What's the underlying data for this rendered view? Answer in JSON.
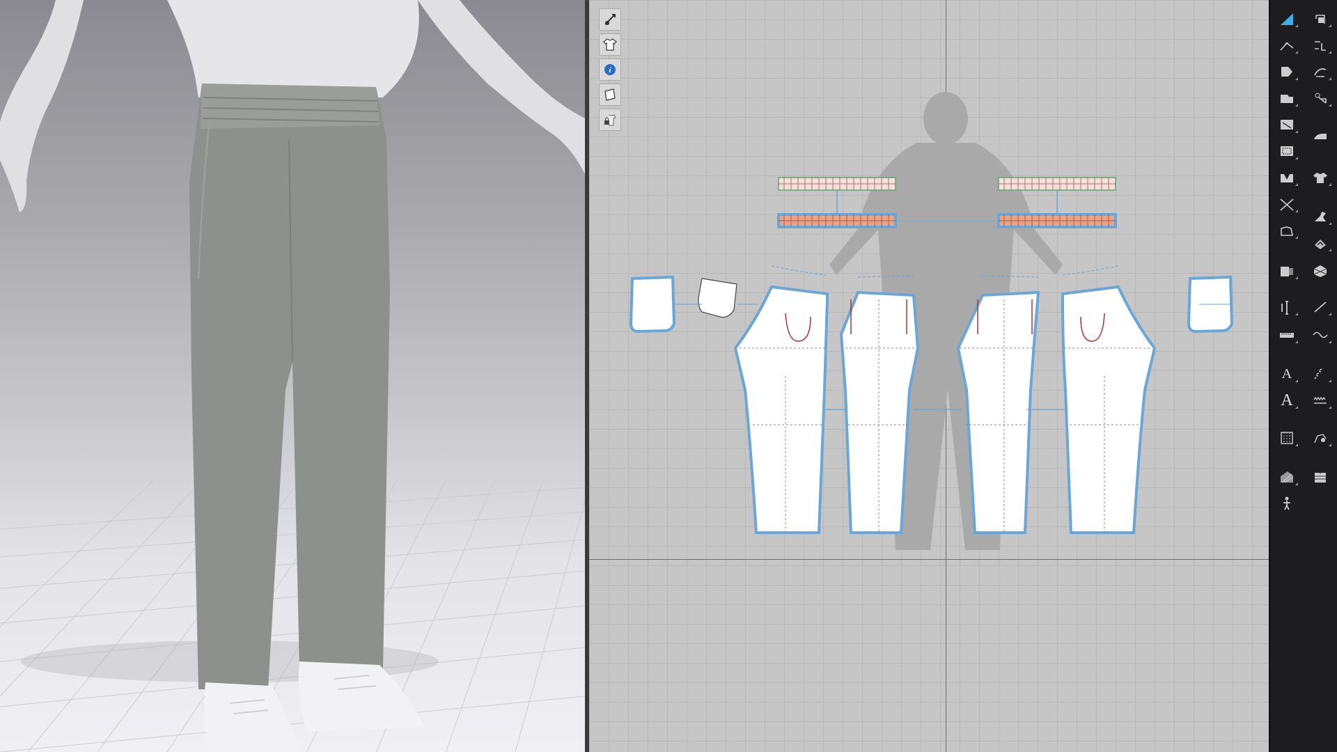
{
  "app": {
    "accent_color": "#3ab0e8",
    "pattern_outline_color": "#6aa6d8",
    "waistband_fill_color": "#e8a486"
  },
  "viewport_3d": {
    "garment": "sweatpants",
    "garment_color": "#8d908c",
    "avatar_color": "#e8e8ea",
    "shoe_color": "#f2f2f4"
  },
  "viewport_2d": {
    "mini_toolbar": [
      {
        "icon": "show-avatar-icon"
      },
      {
        "icon": "show-garment-icon"
      },
      {
        "icon": "info-icon"
      },
      {
        "icon": "show-pattern-icon"
      },
      {
        "icon": "lock-garment-icon"
      }
    ]
  },
  "tool_palette": {
    "left_column": [
      {
        "icon": "edit-pattern-icon",
        "active": true
      },
      {
        "icon": "edit-curvature-icon"
      },
      {
        "icon": "polygon-icon"
      },
      {
        "icon": "rectangle-icon"
      },
      {
        "icon": "internal-polygon-icon"
      },
      {
        "icon": "internal-rectangle-icon"
      },
      {
        "icon": "dart-icon"
      },
      {
        "icon": "segment-sewing-icon"
      },
      {
        "icon": "add-point-icon"
      },
      {
        "icon": "fold-arrangement-icon"
      },
      {
        "icon": "measure-icon"
      },
      {
        "icon": "ruler-icon"
      },
      {
        "icon": "text-icon",
        "text": "A"
      },
      {
        "icon": "text-style-icon",
        "text": "A"
      },
      {
        "icon": "grainline-icon"
      },
      {
        "icon": "texture-icon"
      },
      {
        "icon": "avatar-pose-icon"
      }
    ],
    "right_column": [
      {
        "icon": "transform-pattern-icon"
      },
      {
        "icon": "edit-point-icon"
      },
      {
        "icon": "curve-point-icon"
      },
      {
        "icon": "transform-internal-icon"
      },
      {
        "icon": "steam-iron-icon"
      },
      {
        "icon": "garment-fit-icon"
      },
      {
        "icon": "tuck-icon"
      },
      {
        "icon": "pin-icon"
      },
      {
        "icon": "fold-icon"
      },
      {
        "icon": "stitch-icon"
      },
      {
        "icon": "free-sewing-icon"
      },
      {
        "icon": "zigzag-icon"
      },
      {
        "icon": "elastic-icon"
      },
      {
        "icon": "topstitch-icon"
      },
      {
        "icon": "trim-icon"
      },
      {
        "icon": "button-icon"
      }
    ]
  }
}
